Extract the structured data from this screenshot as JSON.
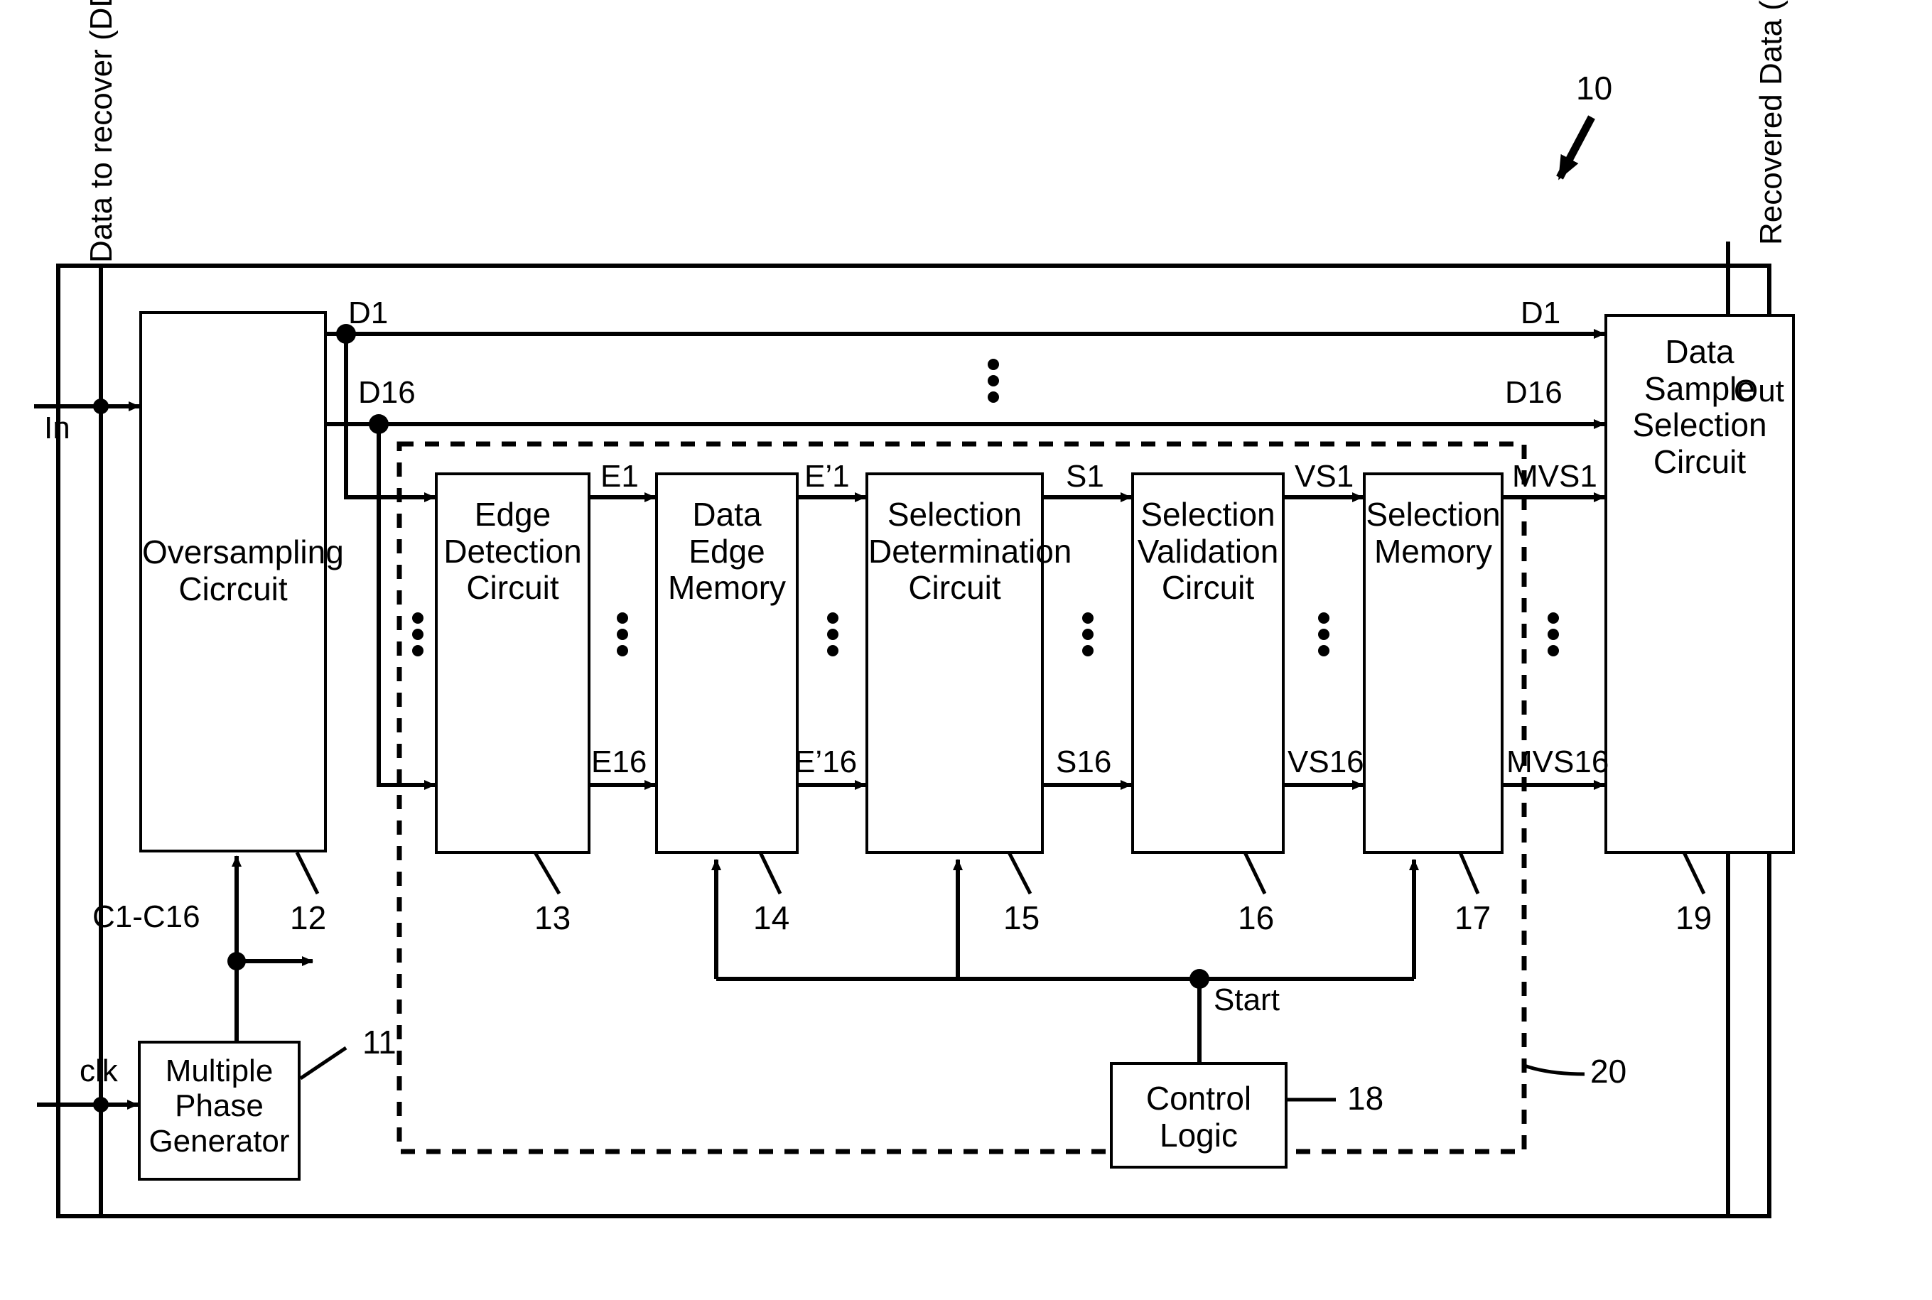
{
  "figure": {
    "ref_system": "10",
    "ref_dashed_group": "20",
    "port_in": "In",
    "port_out": "Out",
    "input_bus_label": "Data to recover (DD)",
    "output_bus_label": "Recovered Data (RD)",
    "clock_input": "clk",
    "clock_phases": "C1-C16",
    "start_signal": "Start"
  },
  "blocks": [
    {
      "id": "mpg",
      "label": "Multiple\nPhase\nGenerator",
      "ref": "11"
    },
    {
      "id": "ovs",
      "label": "Oversampling\nCicrcuit",
      "ref": "12"
    },
    {
      "id": "edc",
      "label": "Edge\nDetection\nCircuit",
      "ref": "13"
    },
    {
      "id": "dem",
      "label": "Data\nEdge\nMemory",
      "ref": "14"
    },
    {
      "id": "sdc",
      "label": "Selection\nDetermination\nCircuit",
      "ref": "15"
    },
    {
      "id": "svc",
      "label": "Selection\nValidation\nCircuit",
      "ref": "16"
    },
    {
      "id": "sm",
      "label": "Selection\nMemory",
      "ref": "17"
    },
    {
      "id": "cl",
      "label": "Control\nLogic",
      "ref": "18"
    },
    {
      "id": "dssc",
      "label": "Data\nSample\nSelection\nCircuit",
      "ref": "19"
    }
  ],
  "bus_labels": {
    "d1_left": "D1",
    "d16_left": "D16",
    "d1_right": "D1",
    "d16_right": "D16",
    "e1": "E1",
    "e16": "E16",
    "ep1": "E’1",
    "ep16": "E’16",
    "s1": "S1",
    "s16": "S16",
    "vs1": "VS1",
    "vs16": "VS16",
    "mvs1": "MVS1",
    "mvs16": "MVS16"
  }
}
